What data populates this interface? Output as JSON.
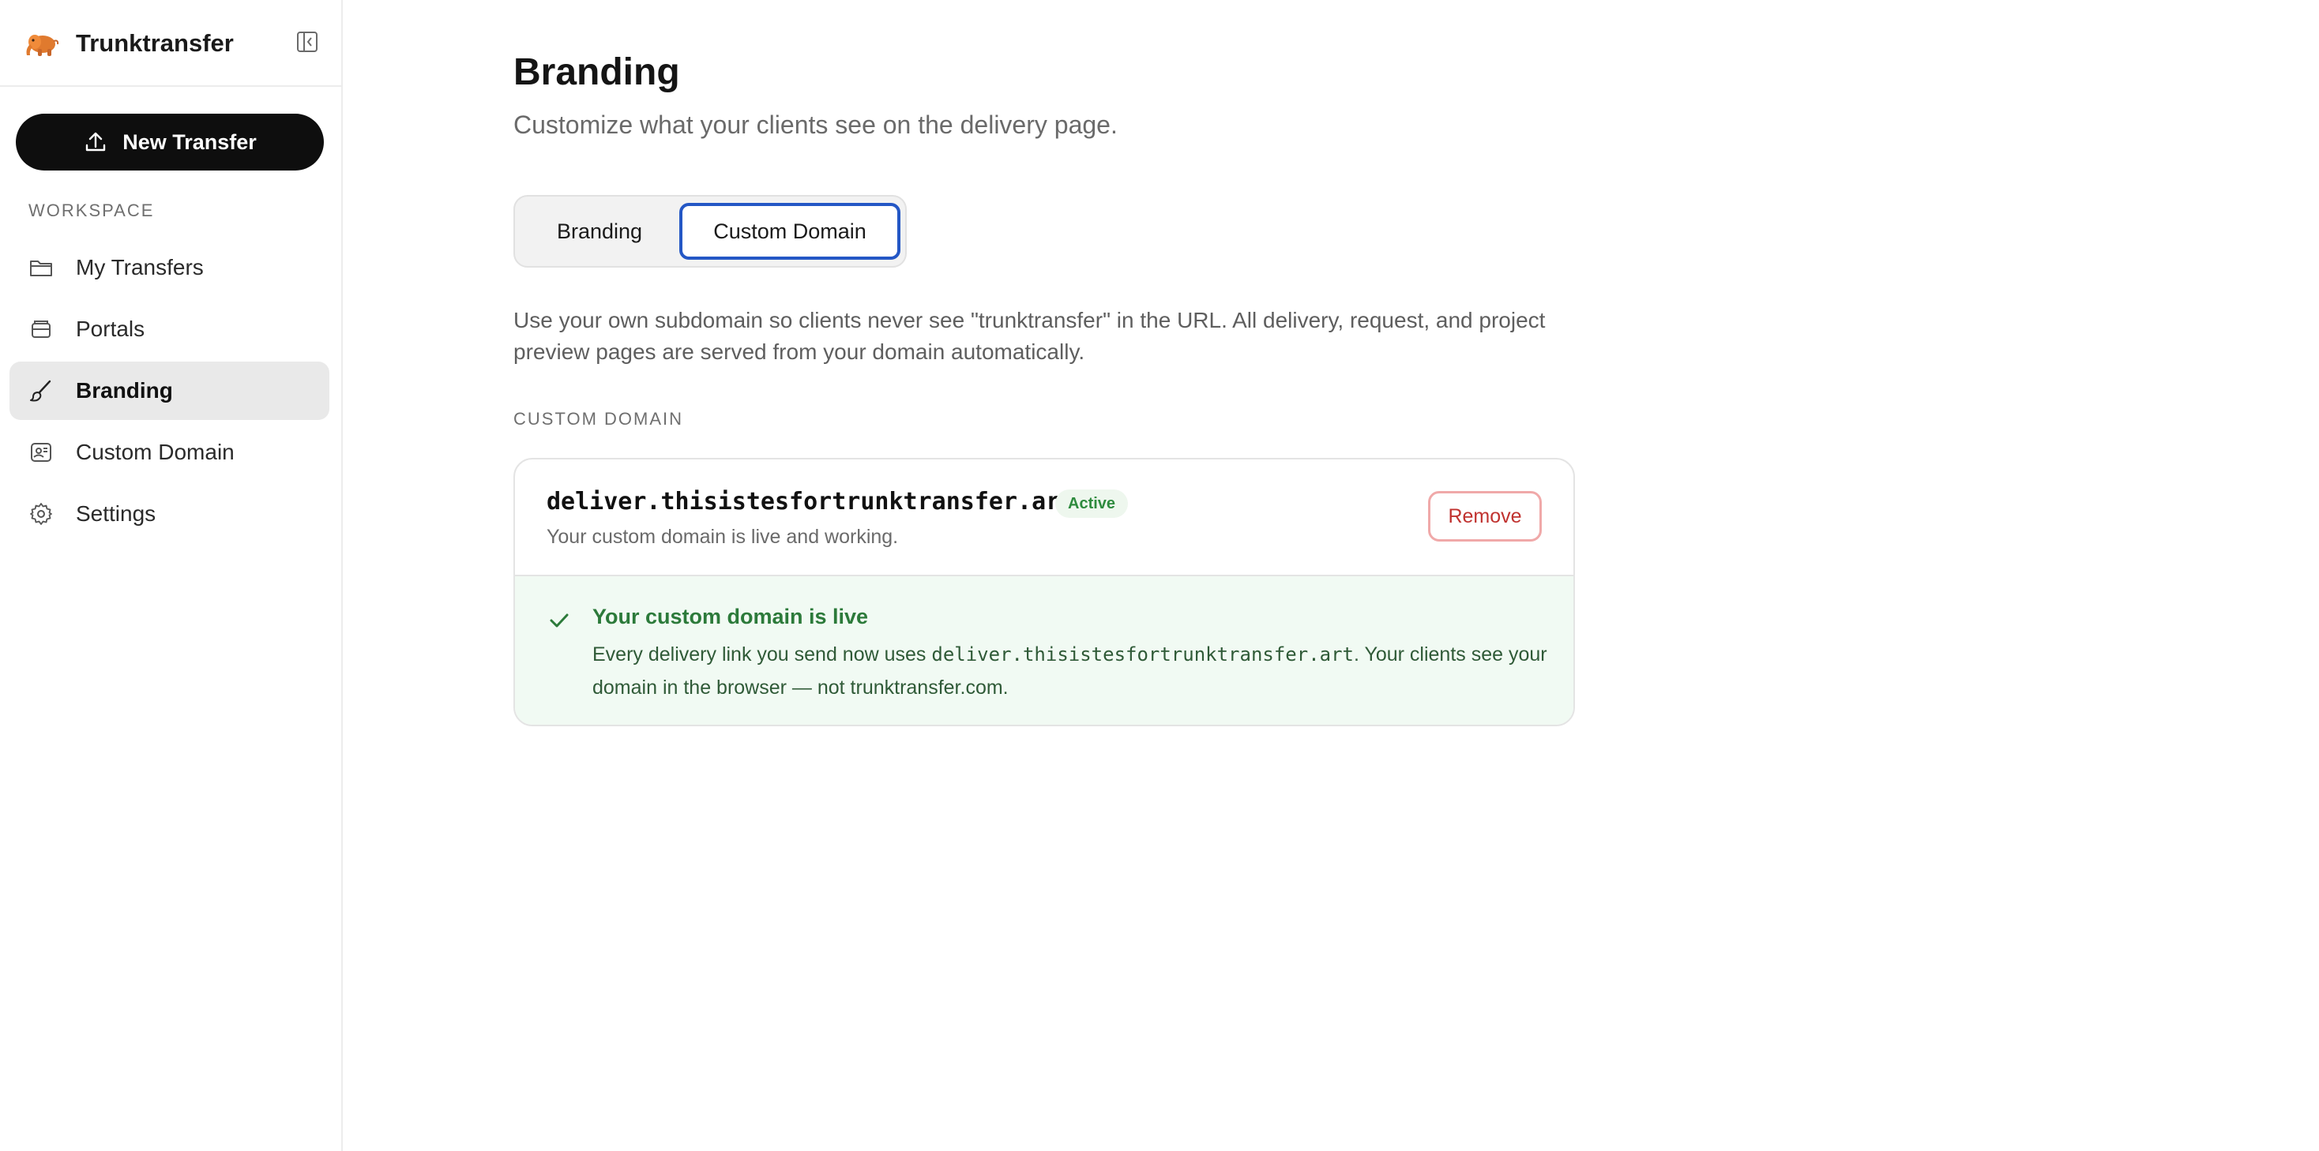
{
  "app": {
    "name": "Trunktransfer",
    "logo_icon": "elephant-logo",
    "collapse_icon": "sidebar-collapse-icon"
  },
  "sidebar": {
    "new_transfer_label": "New Transfer",
    "new_transfer_icon": "upload-icon",
    "section_label": "WORKSPACE",
    "items": [
      {
        "label": "My Transfers",
        "icon": "folder-icon",
        "active": false
      },
      {
        "label": "Portals",
        "icon": "inbox-icon",
        "active": false
      },
      {
        "label": "Branding",
        "icon": "paintbrush-icon",
        "active": true
      },
      {
        "label": "Custom Domain",
        "icon": "domain-icon",
        "active": false
      },
      {
        "label": "Settings",
        "icon": "gear-icon",
        "active": false
      }
    ]
  },
  "main": {
    "title": "Branding",
    "subtitle": "Customize what your clients see on the delivery page.",
    "tabs": [
      {
        "label": "Branding",
        "selected": false
      },
      {
        "label": "Custom Domain",
        "selected": true
      }
    ],
    "description": "Use your own subdomain so clients never see \"trunktransfer\" in the URL. All delivery, request, and project preview pages are served from your domain automatically.",
    "domain_section_label": "CUSTOM DOMAIN",
    "domain": {
      "name": "deliver.thisistesfortrunktransfer.art",
      "status": "Active",
      "note": "Your custom domain is live and working.",
      "remove_label": "Remove",
      "live_title": "Your custom domain is live",
      "live_body_prefix": "Every delivery link you send now uses ",
      "live_body_domain": "deliver.thisistesfortrunktransfer.art",
      "live_body_suffix": ". Your clients see your domain in the browser — not trunktransfer.com."
    }
  },
  "colors": {
    "accent": "#2457c5",
    "button_dark": "#0e0e0e",
    "success": "#2c7a3a",
    "success_bg": "#f1faf3",
    "danger": "#c0322f"
  }
}
